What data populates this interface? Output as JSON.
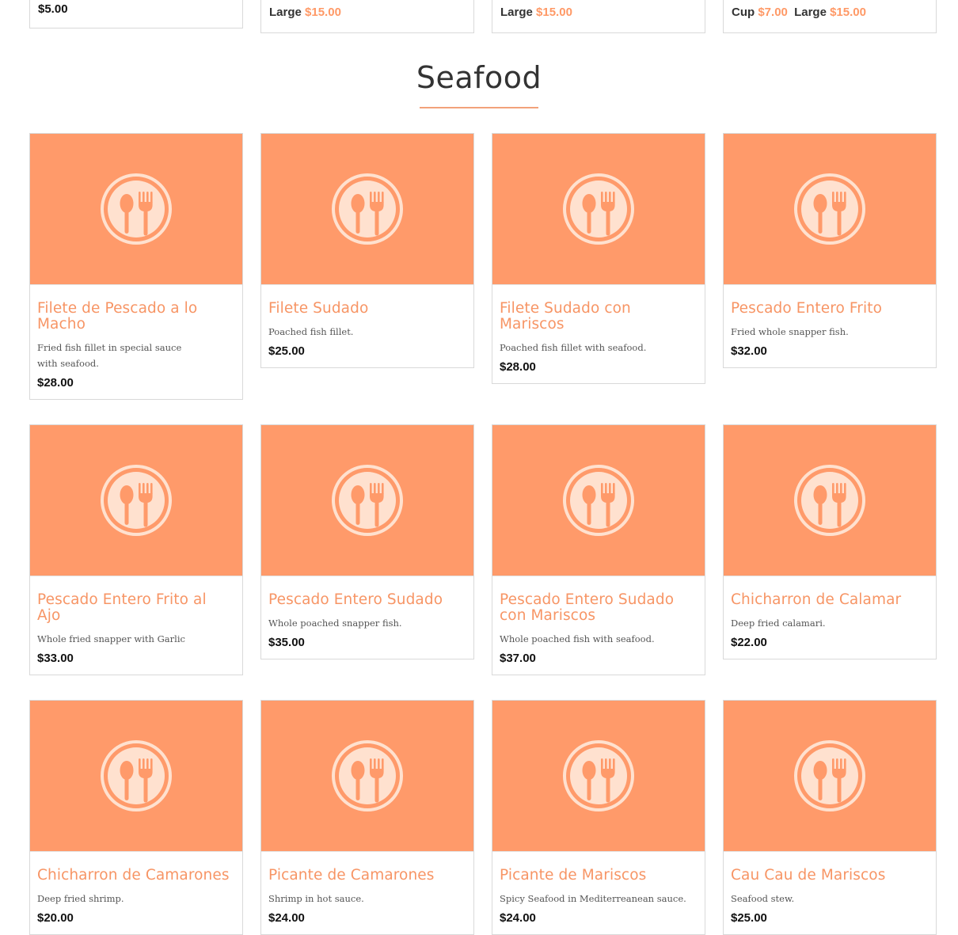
{
  "previous_section": {
    "cards": [
      {
        "price_text": "$5.00"
      },
      {
        "sizes": [
          {
            "label": "Large",
            "price": "$15.00"
          }
        ]
      },
      {
        "sizes": [
          {
            "label": "Large",
            "price": "$15.00"
          }
        ]
      },
      {
        "sizes": [
          {
            "label": "Cup",
            "price": "$7.00"
          },
          {
            "label": "Large",
            "price": "$15.00"
          }
        ]
      }
    ]
  },
  "section": {
    "title": "Seafood"
  },
  "items": [
    {
      "name": "Filete de Pescado a lo Macho",
      "description": "Fried fish fillet in special sauce with seafood.",
      "price": "$28.00"
    },
    {
      "name": "Filete Sudado",
      "description": "Poached fish fillet.",
      "price": "$25.00"
    },
    {
      "name": "Filete Sudado con Mariscos",
      "description": "Poached fish fillet with seafood.",
      "price": "$28.00"
    },
    {
      "name": "Pescado Entero Frito",
      "description": "Fried whole snapper fish.",
      "price": "$32.00"
    },
    {
      "name": "Pescado Entero Frito al Ajo",
      "description": "Whole fried snapper with Garlic",
      "price": "$33.00"
    },
    {
      "name": "Pescado Entero Sudado",
      "description": "Whole poached snapper fish.",
      "price": "$35.00"
    },
    {
      "name": "Pescado Entero Sudado con Mariscos",
      "description": "Whole poached fish with seafood.",
      "price": "$37.00"
    },
    {
      "name": "Chicharron de Calamar",
      "description": "Deep fried calamari.",
      "price": "$22.00"
    },
    {
      "name": "Chicharron de Camarones",
      "description": "Deep fried shrimp.",
      "price": "$20.00"
    },
    {
      "name": "Picante de Camarones",
      "description": "Shrimp in hot sauce.",
      "price": "$24.00"
    },
    {
      "name": "Picante de Mariscos",
      "description": "Spicy Seafood in Mediterreanean sauce.",
      "price": "$24.00"
    },
    {
      "name": "Cau Cau de Mariscos",
      "description": "Seafood stew.",
      "price": "$25.00"
    }
  ],
  "theme": {
    "accent": "#f79565",
    "image_placeholder_bg": "#ff9a6a",
    "icon": "plate-spoon-fork-icon"
  }
}
